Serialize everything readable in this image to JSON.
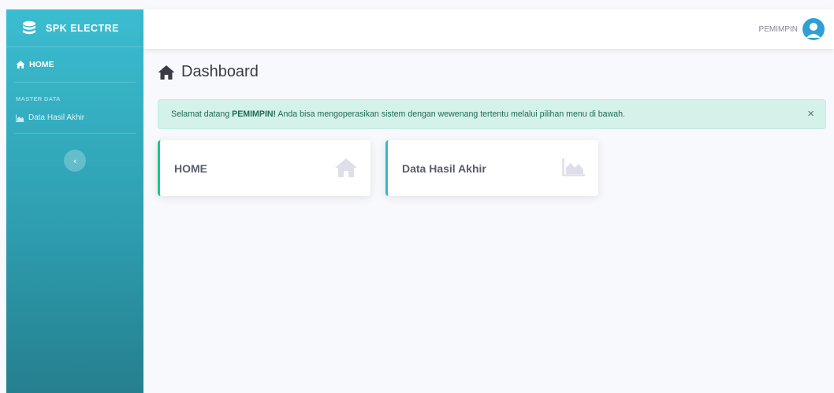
{
  "brand": {
    "name": "SPK ELECTRE",
    "icon": "database-icon"
  },
  "sidebar": {
    "home_label": "HOME",
    "heading": "MASTER DATA",
    "items": [
      {
        "label": "Data Hasil Akhir",
        "icon": "chart-area-icon"
      }
    ],
    "toggle_icon": "chevron-left-icon",
    "colors": {
      "top": "#3bbdd0",
      "bottom": "#257f8e"
    }
  },
  "topbar": {
    "user_name": "PEMIMPIN",
    "avatar_icon": "user-circle-icon"
  },
  "main": {
    "title": "Dashboard",
    "title_icon": "home-icon",
    "alert": {
      "prefix": "Selamat datang ",
      "user": "PEMIMPIN!",
      "suffix": " Anda bisa mengoperasikan sistem dengan wewenang tertentu melalui pilihan menu di bawah.",
      "close": "×"
    },
    "cards": [
      {
        "label": "HOME",
        "icon": "home-icon",
        "accent": "#1cc88a"
      },
      {
        "label": "Data Hasil Akhir",
        "icon": "chart-area-icon",
        "accent": "#36b9cc"
      }
    ]
  }
}
